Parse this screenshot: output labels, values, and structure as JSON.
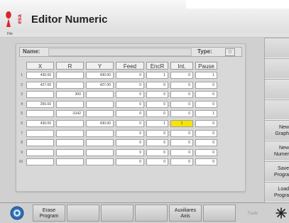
{
  "app": {
    "logo_text": "esa",
    "title": "Editor Numeric"
  },
  "menu": {
    "file": "File"
  },
  "form": {
    "name_label": "Name:",
    "name_value": "",
    "type_label": "Type:",
    "type_value": "0"
  },
  "table": {
    "columns": [
      "X",
      "R",
      "Y",
      "Feed",
      "EncR",
      "Int.",
      "Pause"
    ],
    "rows": [
      {
        "n": "1",
        "cells": [
          "430.00",
          "",
          "430.00",
          "0",
          "1",
          "0",
          "1"
        ]
      },
      {
        "n": "2",
        "cells": [
          "427.00",
          "",
          "427.00",
          "0",
          "0",
          "0",
          "0"
        ]
      },
      {
        "n": "3",
        "cells": [
          "",
          "300",
          "",
          "0",
          "0",
          "0",
          "0"
        ]
      },
      {
        "n": "4",
        "cells": [
          "250.00",
          "",
          "",
          "0",
          "0",
          "0",
          "0"
        ]
      },
      {
        "n": "5",
        "cells": [
          "",
          "-3142",
          "",
          "0",
          "0",
          "0",
          "1"
        ]
      },
      {
        "n": "6",
        "cells": [
          "430.00",
          "",
          "430.00",
          "0",
          "1",
          "1",
          "0"
        ]
      },
      {
        "n": "7",
        "cells": [
          "",
          "",
          "",
          "0",
          "0",
          "0",
          "0"
        ]
      },
      {
        "n": "8",
        "cells": [
          "",
          "",
          "",
          "0",
          "0",
          "0",
          "0"
        ]
      },
      {
        "n": "9",
        "cells": [
          "",
          "",
          "",
          "0",
          "0",
          "0",
          "0"
        ]
      },
      {
        "n": "10",
        "cells": [
          "",
          "",
          "",
          "0",
          "0",
          "0",
          "0"
        ]
      }
    ],
    "highlight_color": "#f7e400"
  },
  "side_buttons": [
    {
      "label": ""
    },
    {
      "label": ""
    },
    {
      "label": ""
    },
    {
      "label": ""
    },
    {
      "label": "New Graph"
    },
    {
      "label": "New Numer"
    },
    {
      "label": "Save Progra"
    },
    {
      "label": "Load Progra"
    }
  ],
  "bottom_buttons": {
    "erase_program": "Erase Program",
    "auxiliares_axis": "Auxiliares Axis"
  },
  "footer": {
    "brand": "Trade"
  },
  "colors": {
    "logo_red": "#d8262b",
    "cnc_blue": "#2c6fb8"
  }
}
